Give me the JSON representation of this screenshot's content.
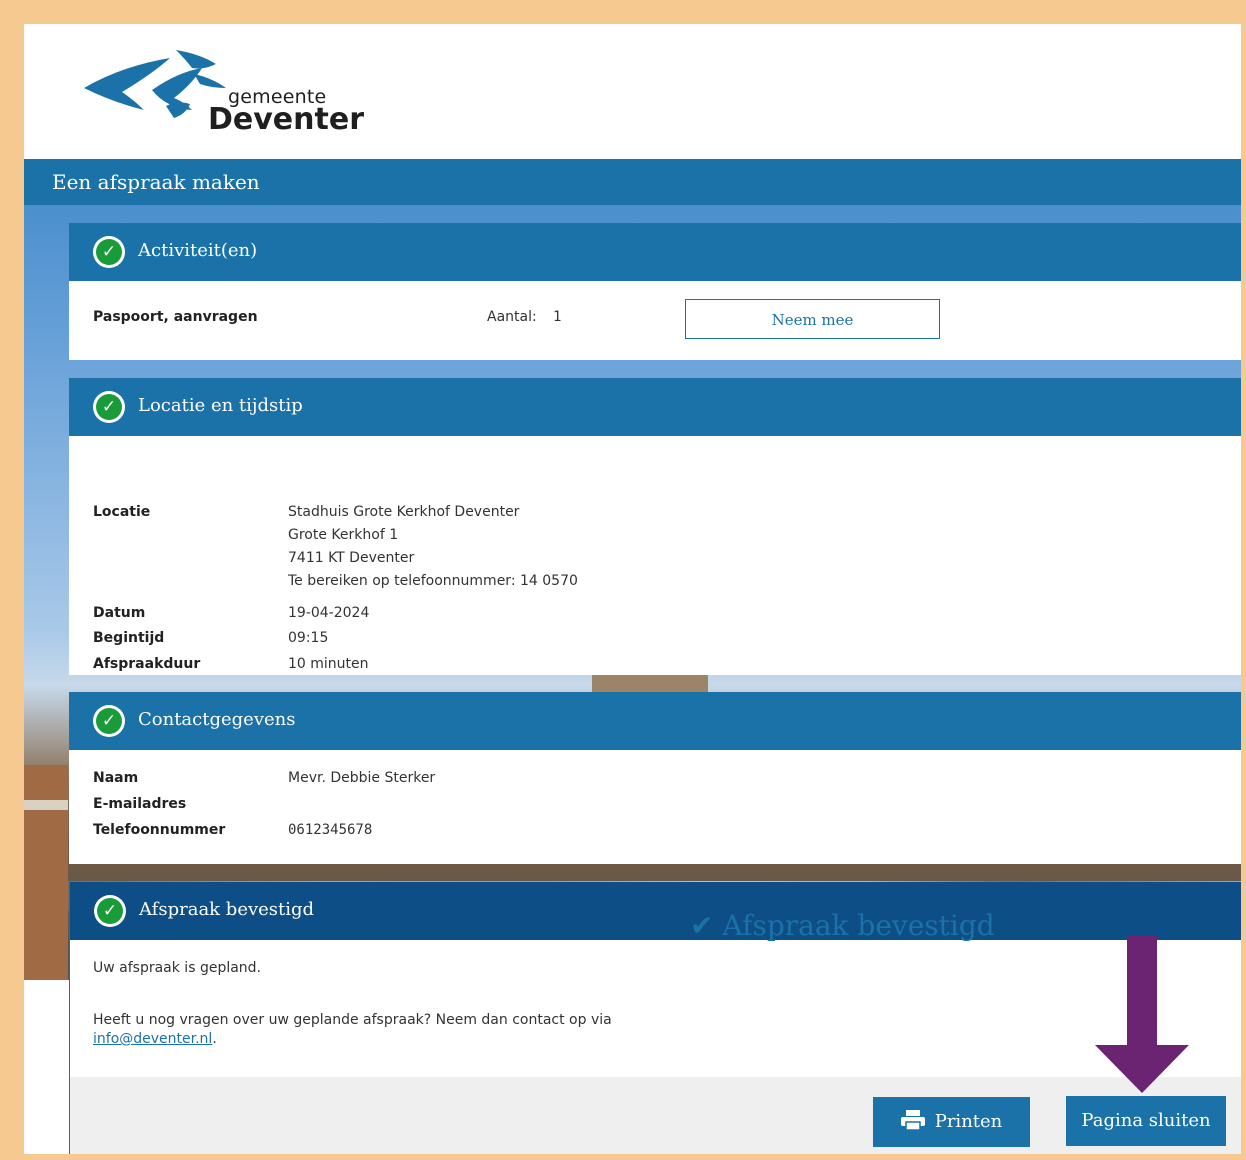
{
  "logo": {
    "small": "gemeente",
    "big": "Deventer"
  },
  "page_title": "Een afspraak maken",
  "activities": {
    "title": "Activiteit(en)",
    "item": "Paspoort, aanvragen",
    "count_label": "Aantal:",
    "count_value": "1",
    "neem_mee_label": "Neem mee"
  },
  "location": {
    "title": "Locatie en tijdstip",
    "locatie_label": "Locatie",
    "address_lines": [
      "Stadhuis Grote Kerkhof Deventer",
      "Grote Kerkhof 1",
      "7411 KT Deventer",
      "Te bereiken op telefoonnummer: 14 0570"
    ],
    "datum_label": "Datum",
    "datum_value": "19-04-2024",
    "begintijd_label": "Begintijd",
    "begintijd_value": "09:15",
    "duur_label": "Afspraakduur",
    "duur_value": "10 minuten"
  },
  "contact": {
    "title": "Contactgegevens",
    "naam_label": "Naam",
    "naam_value": "Mevr. Debbie Sterker",
    "email_label": "E-mailadres",
    "email_value": "",
    "tel_label": "Telefoonnummer",
    "tel_value": "0612345678"
  },
  "confirmation": {
    "title": "Afspraak bevestigd",
    "planned_text": "Uw afspraak is gepland.",
    "question_text": "Heeft u nog vragen over uw geplande afspraak? Neem dan contact op via",
    "email_link": "info@deventer.nl",
    "suffix": ".",
    "big_text": "Afspraak bevestigd",
    "print_label": "Printen",
    "close_label": "Pagina sluiten"
  },
  "colors": {
    "brand_blue": "#1a72a8",
    "dark_blue": "#0e4e86",
    "check_green": "#1a9b3a",
    "frame": "#f5c98f",
    "arrow": "#6b2472"
  },
  "icons": [
    "check-circle-icon",
    "checkmark-icon",
    "printer-icon",
    "arrow-down-icon",
    "deventer-logo"
  ]
}
